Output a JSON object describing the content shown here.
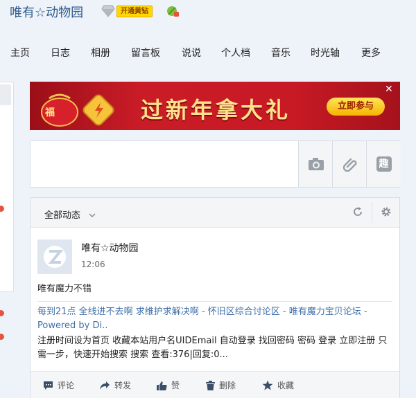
{
  "header": {
    "title": "唯有☆动物园",
    "vip_badge": "开通黄钻"
  },
  "nav": {
    "items": [
      "主页",
      "日志",
      "相册",
      "留言板",
      "说说",
      "个人档",
      "音乐",
      "时光轴",
      "更多"
    ]
  },
  "banner": {
    "title": "过新年拿大礼",
    "cta": "立即参与",
    "fu_char": "福"
  },
  "composer": {
    "tool_fun_label": "趣"
  },
  "feed": {
    "filter_label": "全部动态",
    "post": {
      "author": "唯有☆动物园",
      "time": "12:06",
      "text": "唯有魔力不错",
      "link_text": "每到21点 全线进不去啊 求维护求解决啊 - 怀旧区综合讨论区 - 唯有魔力宝贝论坛 - Powered by Di..",
      "summary": "注册时间设为首页 收藏本站用户名UIDEmail 自动登录 找回密码 密码 登录 立即注册 只需一步，快速开始搜索 搜索 查看:376|回复:0..."
    },
    "actions": {
      "comment": "评论",
      "forward": "转发",
      "like": "赞",
      "delete": "删除",
      "favorite": "收藏"
    }
  }
}
